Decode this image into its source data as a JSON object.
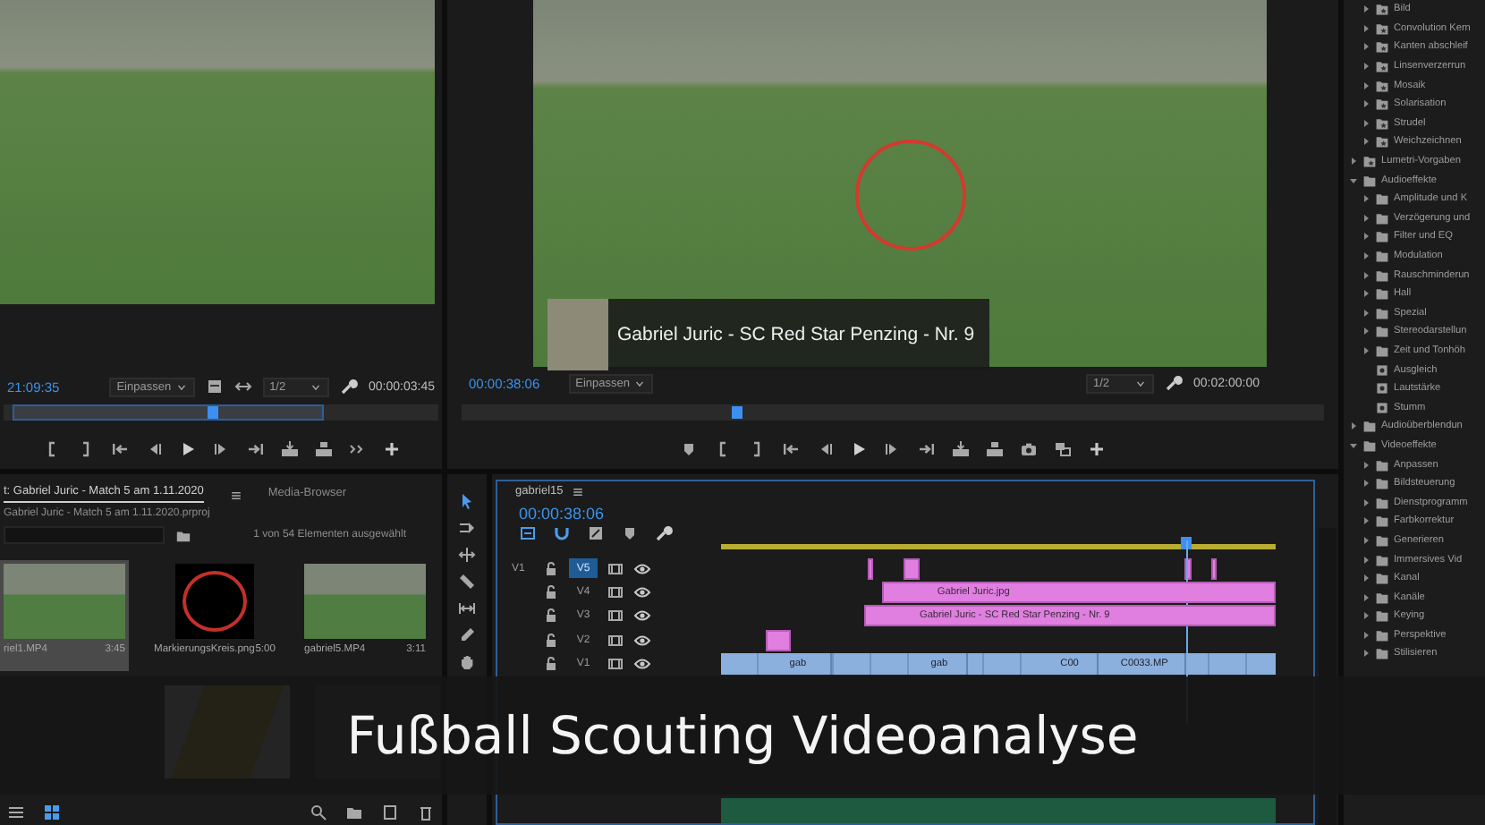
{
  "source_monitor": {
    "timecode": "21:09:35",
    "zoom": "Einpassen",
    "resolution": "1/2",
    "duration": "00:00:03:45",
    "level": 0.48
  },
  "program_monitor": {
    "lower_third": "Gabriel Juric - SC Red Star Penzing - Nr. 9",
    "timecode": "00:00:38:06",
    "zoom": "Einpassen",
    "resolution": "1/2",
    "duration": "00:02:00:00",
    "level": 0.32
  },
  "effects": {
    "continued_items": [
      {
        "label": "Bild",
        "kind": "preset-folder",
        "expanded": false
      },
      {
        "label": "Convolution Kern",
        "kind": "preset-folder",
        "expanded": false
      },
      {
        "label": "Kanten abschleif",
        "kind": "preset-folder",
        "expanded": false
      },
      {
        "label": "Linsenverzerrun",
        "kind": "preset-folder",
        "expanded": false
      },
      {
        "label": "Mosaik",
        "kind": "preset-folder",
        "expanded": false
      },
      {
        "label": "Solarisation",
        "kind": "preset-folder",
        "expanded": false
      },
      {
        "label": "Strudel",
        "kind": "preset-folder",
        "expanded": false
      },
      {
        "label": "Weichzeichnen",
        "kind": "preset-folder",
        "expanded": false
      }
    ],
    "items": [
      {
        "label": "Lumetri-Vorgaben",
        "kind": "preset-folder",
        "expanded": false
      },
      {
        "label": "Audioeffekte",
        "kind": "folder",
        "expanded": true,
        "children": [
          {
            "label": "Amplitude und K",
            "kind": "folder",
            "expanded": false
          },
          {
            "label": "Verzögerung und",
            "kind": "folder",
            "expanded": false
          },
          {
            "label": "Filter und EQ",
            "kind": "folder",
            "expanded": false
          },
          {
            "label": "Modulation",
            "kind": "folder",
            "expanded": false
          },
          {
            "label": "Rauschminderun",
            "kind": "folder",
            "expanded": false
          },
          {
            "label": "Hall",
            "kind": "folder",
            "expanded": false
          },
          {
            "label": "Spezial",
            "kind": "folder",
            "expanded": false
          },
          {
            "label": "Stereodarstellun",
            "kind": "folder",
            "expanded": false
          },
          {
            "label": "Zeit und Tonhöh",
            "kind": "folder",
            "expanded": false
          },
          {
            "label": "Ausgleich",
            "kind": "effect"
          },
          {
            "label": "Lautstärke",
            "kind": "effect"
          },
          {
            "label": "Stumm",
            "kind": "effect"
          }
        ]
      },
      {
        "label": "Audioüberblendun",
        "kind": "folder",
        "expanded": false
      },
      {
        "label": "Videoeffekte",
        "kind": "folder",
        "expanded": true,
        "children": [
          {
            "label": "Anpassen",
            "kind": "folder",
            "expanded": false
          },
          {
            "label": "Bildsteuerung",
            "kind": "folder",
            "expanded": false
          },
          {
            "label": "Dienstprogramm",
            "kind": "folder",
            "expanded": false
          },
          {
            "label": "Farbkorrektur",
            "kind": "folder",
            "expanded": false
          },
          {
            "label": "Generieren",
            "kind": "folder",
            "expanded": false
          },
          {
            "label": "Immersives Vid",
            "kind": "folder",
            "expanded": false
          },
          {
            "label": "Kanal",
            "kind": "folder",
            "expanded": false
          },
          {
            "label": "Kanäle",
            "kind": "folder",
            "expanded": false
          },
          {
            "label": "Keying",
            "kind": "folder",
            "expanded": false
          },
          {
            "label": "Perspektive",
            "kind": "folder",
            "expanded": false
          },
          {
            "label": "Stilisieren",
            "kind": "folder",
            "expanded": false
          }
        ]
      }
    ]
  },
  "project": {
    "tabs": [
      {
        "label": "t: Gabriel Juric - Match 5 am 1.11.2020",
        "selected": true
      },
      {
        "label": "Media-Browser",
        "selected": false
      }
    ],
    "path": "Gabriel Juric - Match 5 am 1.11.2020.prproj",
    "selection_info": "1 von 54 Elementen ausgewählt",
    "items": [
      {
        "name": "riel1.MP4",
        "duration": "3:45",
        "kind": "video",
        "selected": true
      },
      {
        "name": "MarkierungsKreis.png",
        "duration": "5:00",
        "kind": "ring",
        "selected": false
      },
      {
        "name": "gabriel5.MP4",
        "duration": "3:11",
        "kind": "video",
        "selected": false
      }
    ]
  },
  "timeline": {
    "tab": "gabriel15",
    "timecode": "00:00:38:06",
    "level": 0.84,
    "tracks": [
      {
        "label": "V5",
        "source": "V1",
        "targeted": true,
        "clips": [
          {
            "kind": "bit"
          },
          {
            "kind": "bit"
          },
          {
            "kind": "bit"
          },
          {
            "kind": "bit"
          }
        ]
      },
      {
        "label": "V4",
        "targeted": false,
        "clips": [
          {
            "kind": "title",
            "label": "Gabriel Juric.jpg"
          }
        ]
      },
      {
        "label": "V3",
        "targeted": false,
        "clips": [
          {
            "kind": "title",
            "label": "Gabriel Juric - SC Red Star Penzing - Nr. 9"
          }
        ]
      },
      {
        "label": "V2",
        "targeted": false,
        "clips": [
          {
            "kind": "bit"
          }
        ]
      },
      {
        "label": "V1",
        "targeted": false,
        "clips": [
          {
            "kind": "video",
            "label": "gab"
          },
          {
            "kind": "video",
            "label": "gab"
          },
          {
            "kind": "video",
            "label": "C00"
          },
          {
            "kind": "video",
            "label": "C0033.MP"
          }
        ]
      }
    ]
  },
  "banner": {
    "title": "Fußball Scouting Videoanalyse"
  }
}
